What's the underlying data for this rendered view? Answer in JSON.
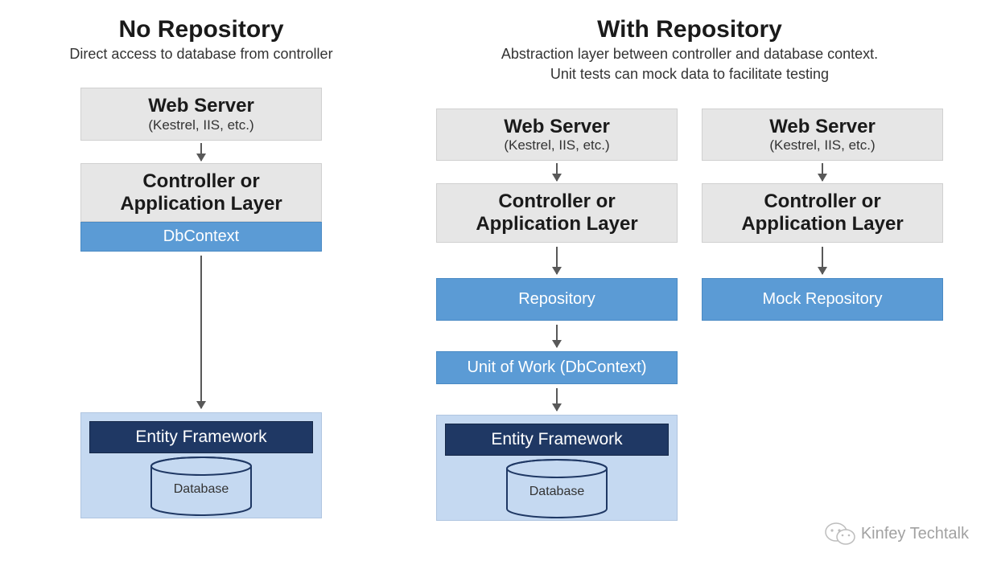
{
  "left": {
    "heading": "No Repository",
    "subheading": "Direct access to database from controller",
    "webserver_title": "Web Server",
    "webserver_sub": "(Kestrel, IIS, etc.)",
    "controller_line1": "Controller or",
    "controller_line2": "Application Layer",
    "dbcontext": "DbContext",
    "ef_title": "Entity Framework",
    "db_label": "Database"
  },
  "right": {
    "heading": "With Repository",
    "sub_line1": "Abstraction layer between controller and database context.",
    "sub_line2": "Unit tests can mock data to facilitate testing",
    "colA": {
      "webserver_title": "Web Server",
      "webserver_sub": "(Kestrel, IIS, etc.)",
      "controller_line1": "Controller or",
      "controller_line2": "Application Layer",
      "repository": "Repository",
      "uow": "Unit of Work (DbContext)",
      "ef_title": "Entity Framework",
      "db_label": "Database"
    },
    "colB": {
      "webserver_title": "Web Server",
      "webserver_sub": "(Kestrel, IIS, etc.)",
      "controller_line1": "Controller or",
      "controller_line2": "Application Layer",
      "mock_repo": "Mock Repository"
    }
  },
  "watermark": "Kinfey Techtalk",
  "colors": {
    "gray_box": "#e6e6e6",
    "blue_box": "#5b9bd5",
    "ef_bg": "#c5d9f1",
    "ef_title": "#1f3864",
    "arrow": "#595959"
  }
}
